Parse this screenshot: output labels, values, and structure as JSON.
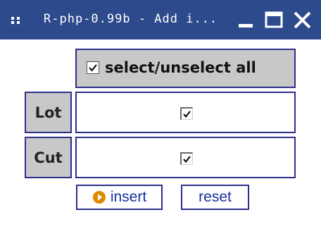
{
  "window": {
    "title": "R-php-0.99b - Add i..."
  },
  "colors": {
    "titlebar": "#2d4a8d",
    "cell_border": "#2e2e8a",
    "label_bg": "#c8c8c8",
    "button_text": "#1a2f9a",
    "play_icon": "#e08a00"
  },
  "form": {
    "header": {
      "label": "select/unselect all",
      "checked": true
    },
    "rows": [
      {
        "label": "Lot",
        "checked": true
      },
      {
        "label": "Cut",
        "checked": true
      }
    ]
  },
  "buttons": {
    "insert": {
      "label": "insert",
      "icon": "play-circle-icon"
    },
    "reset": {
      "label": "reset"
    }
  },
  "icons": {
    "menu": "menu-grip-icon",
    "minimize": "minimize-icon",
    "maximize": "maximize-icon",
    "close": "close-icon"
  }
}
